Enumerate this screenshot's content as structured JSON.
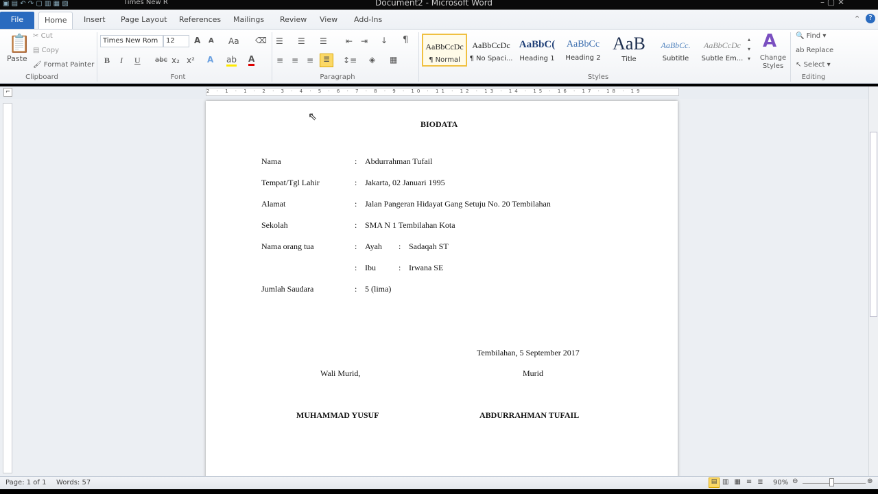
{
  "window": {
    "title": "Document2 - Microsoft Word",
    "qat_font": "Times New R"
  },
  "tabs": [
    "File",
    "Home",
    "Insert",
    "Page Layout",
    "References",
    "Mailings",
    "Review",
    "View",
    "Add-Ins"
  ],
  "clipboard": {
    "paste": "Paste",
    "cut": "Cut",
    "copy": "Copy",
    "format_painter": "Format Painter",
    "group": "Clipboard"
  },
  "font": {
    "name": "Times New Rom",
    "size": "12",
    "group": "Font",
    "bold": "B",
    "italic": "I",
    "underline": "U",
    "strike": "abc",
    "sub": "x₂",
    "sup": "x²",
    "grow": "A",
    "shrink": "A",
    "case": "Aa"
  },
  "paragraph": {
    "group": "Paragraph",
    "pilcrow": "¶"
  },
  "styles": {
    "group": "Styles",
    "items": [
      {
        "preview": "AaBbCcDc",
        "label": "¶ Normal"
      },
      {
        "preview": "AaBbCcDc",
        "label": "¶ No Spaci..."
      },
      {
        "preview": "AaBbC(",
        "label": "Heading 1"
      },
      {
        "preview": "AaBbCc",
        "label": "Heading 2"
      },
      {
        "preview": "AaB",
        "label": "Title"
      },
      {
        "preview": "AaBbCc.",
        "label": "Subtitle"
      },
      {
        "preview": "AaBbCcDc",
        "label": "Subtle Em..."
      }
    ],
    "change_styles": "Change Styles"
  },
  "editing": {
    "group": "Editing",
    "find": "Find",
    "replace": "Replace",
    "select": "Select"
  },
  "ruler_text": "2 · 1 · 1 · 2 · 3 · 4 · 5 · 6 · 7 · 8 · 9 · 10 · 11 · 12 · 13 · 14 · 15 · 16 · 17 · 18 · 19",
  "document": {
    "title": "BIODATA",
    "rows": [
      {
        "label": "Nama",
        "value": "Abdurrahman  Tufail"
      },
      {
        "label": "Tempat/Tgl Lahir",
        "value": "Jakarta, 02 Januari 1995"
      },
      {
        "label": "Alamat",
        "value": "Jalan Pangeran Hidayat  Gang Setuju No. 20 Tembilahan"
      },
      {
        "label": "Sekolah",
        "value": "SMA N 1 Tembilahan Kota"
      },
      {
        "label": "Nama orang tua",
        "value": "Ayah",
        "sub": "Sadaqah ST"
      },
      {
        "label": "",
        "value": "Ibu",
        "sub": "Irwana SE"
      },
      {
        "label": "Jumlah Saudara",
        "value": "5 (lima)"
      }
    ],
    "colon": ":",
    "place_date": "Tembilahan,  5 September 2017",
    "left_role": "Wali Murid,",
    "right_role": "Murid",
    "left_name": "MUHAMMAD YUSUF",
    "right_name": "ABDURRAHMAN  TUFAIL"
  },
  "status": {
    "page": "Page: 1 of 1",
    "words": "Words: 57",
    "zoom": "90%",
    "zoom_level": 90
  }
}
